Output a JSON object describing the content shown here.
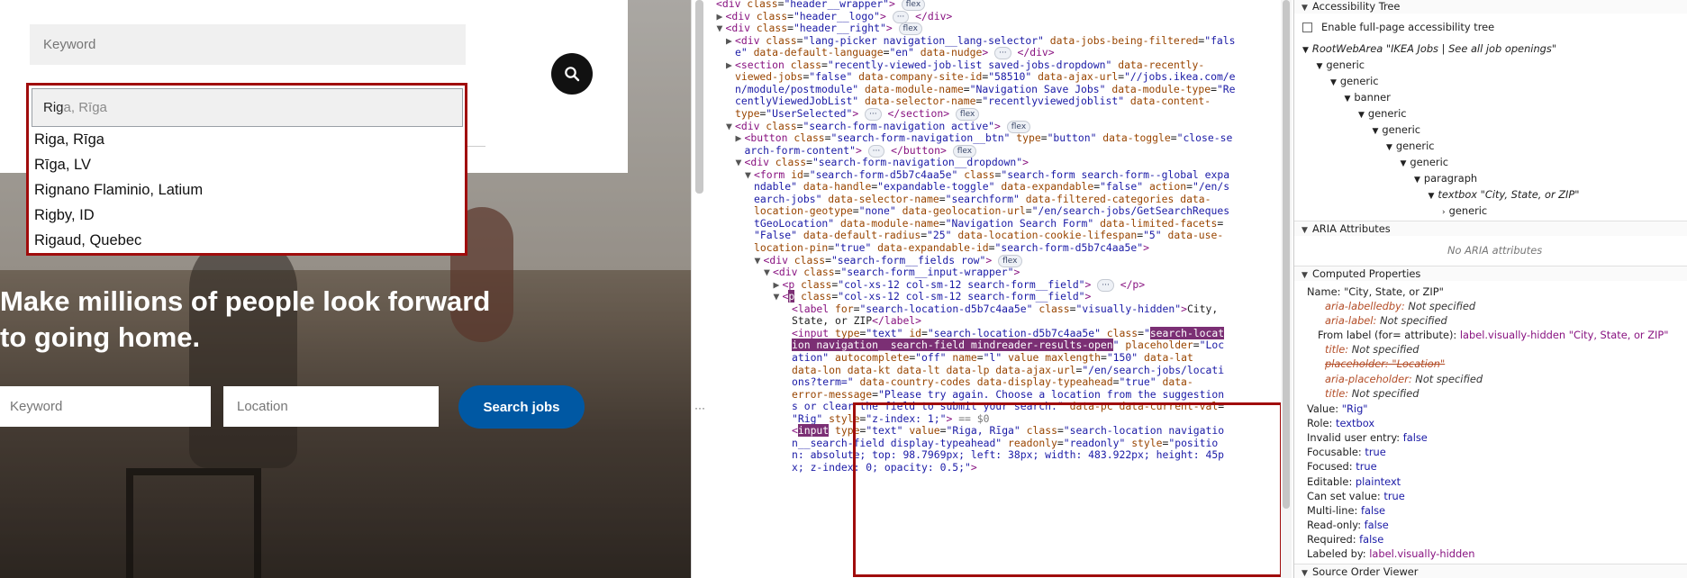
{
  "page": {
    "search_panel": {
      "keyword_placeholder": "Keyword",
      "location_typed": "Rig",
      "location_hint": "a, Rīga",
      "suggestions": [
        "Riga, Rīga",
        "Rīga, LV",
        "Rignano Flaminio, Latium",
        "Rigby, ID",
        "Rigaud, Quebec"
      ]
    },
    "hero": {
      "headline_line1": "Make millions of people look forward",
      "headline_line2": "to going home.",
      "keyword_placeholder": "Keyword",
      "location_placeholder": "Location",
      "search_button": "Search jobs"
    }
  },
  "elements": {
    "lines": [
      {
        "indent": 0,
        "tri": "",
        "html": "<span class=\"tag\">&lt;div</span> <span class=\"attr\">class</span>=<span class=\"val\">\"header__wrapper\"</span><span class=\"tag\">&gt;</span> <span class=\"badge\">flex</span>"
      },
      {
        "indent": 1,
        "tri": "▶",
        "html": "<span class=\"tag\">&lt;div</span> <span class=\"attr\">class</span>=<span class=\"val\">\"header__logo\"</span><span class=\"tag\">&gt;</span> <span class=\"badge\">···</span> <span class=\"tag\">&lt;/div&gt;</span>"
      },
      {
        "indent": 1,
        "tri": "▼",
        "html": "<span class=\"tag\">&lt;div</span> <span class=\"attr\">class</span>=<span class=\"val\">\"header__right\"</span><span class=\"tag\">&gt;</span> <span class=\"badge\">flex</span>"
      },
      {
        "indent": 2,
        "tri": "▶",
        "html": "<span class=\"tag\">&lt;div</span> <span class=\"attr\">class</span>=<span class=\"val\">\"lang-picker navigation__lang-selector\"</span> <span class=\"attr\">data-jobs-being-filtered</span>=<span class=\"val\">\"fals</span>"
      },
      {
        "indent": 2,
        "tri": "",
        "html": "<span class=\"val\">e\"</span> <span class=\"attr\">data-default-language</span>=<span class=\"val\">\"en\"</span> <span class=\"attr\">data-nudge</span><span class=\"tag\">&gt;</span> <span class=\"badge\">···</span> <span class=\"tag\">&lt;/div&gt;</span>"
      },
      {
        "indent": 2,
        "tri": "▶",
        "html": "<span class=\"tag\">&lt;section</span> <span class=\"attr\">class</span>=<span class=\"val\">\"recently-viewed-job-list saved-jobs-dropdown\"</span> <span class=\"attr\">data-recently-</span>"
      },
      {
        "indent": 2,
        "tri": "",
        "html": "<span class=\"attr\">viewed-jobs</span>=<span class=\"val\">\"false\"</span> <span class=\"attr\">data-company-site-id</span>=<span class=\"val\">\"58510\"</span> <span class=\"attr\">data-ajax-url</span>=<span class=\"val\">\"//jobs.ikea.com/e</span>"
      },
      {
        "indent": 2,
        "tri": "",
        "html": "<span class=\"val\">n/module/postmodule\"</span> <span class=\"attr\">data-module-name</span>=<span class=\"val\">\"Navigation Save Jobs\"</span> <span class=\"attr\">data-module-type</span>=<span class=\"val\">\"Re</span>"
      },
      {
        "indent": 2,
        "tri": "",
        "html": "<span class=\"val\">centlyViewedJobList\"</span> <span class=\"attr\">data-selector-name</span>=<span class=\"val\">\"recentlyviewedjoblist\"</span> <span class=\"attr\">data-content-</span>"
      },
      {
        "indent": 2,
        "tri": "",
        "html": "<span class=\"attr\">type</span>=<span class=\"val\">\"UserSelected\"</span><span class=\"tag\">&gt;</span> <span class=\"badge\">···</span> <span class=\"tag\">&lt;/section&gt;</span> <span class=\"badge\">flex</span>"
      },
      {
        "indent": 2,
        "tri": "▼",
        "html": "<span class=\"tag\">&lt;div</span> <span class=\"attr\">class</span>=<span class=\"val\">\"search-form-navigation active\"</span><span class=\"tag\">&gt;</span> <span class=\"badge\">flex</span>"
      },
      {
        "indent": 3,
        "tri": "▶",
        "html": "<span class=\"tag\">&lt;button</span> <span class=\"attr\">class</span>=<span class=\"val\">\"search-form-navigation__btn\"</span> <span class=\"attr\">type</span>=<span class=\"val\">\"button\"</span> <span class=\"attr\">data-toggle</span>=<span class=\"val\">\"close-se</span>"
      },
      {
        "indent": 3,
        "tri": "",
        "html": "<span class=\"val\">arch-form-content\"</span><span class=\"tag\">&gt;</span> <span class=\"badge\">···</span> <span class=\"tag\">&lt;/button&gt;</span> <span class=\"badge\">flex</span>"
      },
      {
        "indent": 3,
        "tri": "▼",
        "html": "<span class=\"tag\">&lt;div</span> <span class=\"attr\">class</span>=<span class=\"val\">\"search-form-navigation__dropdown\"</span><span class=\"tag\">&gt;</span>"
      },
      {
        "indent": 4,
        "tri": "▼",
        "html": "<span class=\"tag\">&lt;form</span> <span class=\"attr\">id</span>=<span class=\"val\">\"search-form-d5b7c4aa5e\"</span> <span class=\"attr\">class</span>=<span class=\"val\">\"search-form search-form--global expa</span>"
      },
      {
        "indent": 4,
        "tri": "",
        "html": "<span class=\"val\">ndable\"</span> <span class=\"attr\">data-handle</span>=<span class=\"val\">\"expandable-toggle\"</span> <span class=\"attr\">data-expandable</span>=<span class=\"val\">\"false\"</span> <span class=\"attr\">action</span>=<span class=\"val\">\"/en/s</span>"
      },
      {
        "indent": 4,
        "tri": "",
        "html": "<span class=\"val\">earch-jobs\"</span> <span class=\"attr\">data-selector-name</span>=<span class=\"val\">\"searchform\"</span> <span class=\"attr\">data-filtered-categories</span> <span class=\"attr\">data-</span>"
      },
      {
        "indent": 4,
        "tri": "",
        "html": "<span class=\"attr\">location-geotype</span>=<span class=\"val\">\"none\"</span> <span class=\"attr\">data-geolocation-url</span>=<span class=\"val\">\"/en/search-jobs/GetSearchReques</span>"
      },
      {
        "indent": 4,
        "tri": "",
        "html": "<span class=\"val\">tGeoLocation\"</span> <span class=\"attr\">data-module-name</span>=<span class=\"val\">\"Navigation Search Form\"</span> <span class=\"attr\">data-limited-facets</span>="
      },
      {
        "indent": 4,
        "tri": "",
        "html": "<span class=\"val\">\"False\"</span> <span class=\"attr\">data-default-radius</span>=<span class=\"val\">\"25\"</span> <span class=\"attr\">data-location-cookie-lifespan</span>=<span class=\"val\">\"5\"</span> <span class=\"attr\">data-use-</span>"
      },
      {
        "indent": 4,
        "tri": "",
        "html": "<span class=\"attr\">location-pin</span>=<span class=\"val\">\"true\"</span> <span class=\"attr\">data-expandable-id</span>=<span class=\"val\">\"search-form-d5b7c4aa5e\"</span><span class=\"tag\">&gt;</span>"
      },
      {
        "indent": 5,
        "tri": "▼",
        "html": "<span class=\"tag\">&lt;div</span> <span class=\"attr\">class</span>=<span class=\"val\">\"search-form__fields row\"</span><span class=\"tag\">&gt;</span> <span class=\"badge\">flex</span>"
      },
      {
        "indent": 6,
        "tri": "▼",
        "html": "<span class=\"tag\">&lt;div</span> <span class=\"attr\">class</span>=<span class=\"val\">\"search-form__input-wrapper\"</span><span class=\"tag\">&gt;</span>"
      },
      {
        "indent": 7,
        "tri": "▶",
        "html": "<span class=\"tag\">&lt;p</span> <span class=\"attr\">class</span>=<span class=\"val\">\"col-xs-12 col-sm-12 search-form__field\"</span><span class=\"tag\">&gt;</span> <span class=\"badge\">···</span> <span class=\"tag\">&lt;/p&gt;</span>"
      },
      {
        "indent": 7,
        "tri": "▼",
        "html": "<span class=\"tag\">&lt;</span><span class=\"hl\">p</span> <span class=\"attr\">class</span>=<span class=\"val\">\"col-xs-12 col-sm-12 search-form__field\"</span><span class=\"tag\">&gt;</span>"
      },
      {
        "indent": 8,
        "tri": "",
        "html": "<span class=\"tag\">&lt;label</span> <span class=\"attr\">for</span>=<span class=\"val\">\"search-location-d5b7c4aa5e\"</span> <span class=\"attr\">class</span>=<span class=\"val\">\"visually-hidden\"</span><span class=\"tag\">&gt;</span><span class=\"txt\">City,</span>"
      },
      {
        "indent": 8,
        "tri": "",
        "html": "<span class=\"txt\">State, or ZIP</span><span class=\"tag\">&lt;/label&gt;</span>"
      },
      {
        "indent": 8,
        "tri": "",
        "html": "<span class=\"tag\">&lt;input</span> <span class=\"attr\">type</span>=<span class=\"val\">\"text\"</span> <span class=\"attr\">id</span>=<span class=\"val\">\"search-location-d5b7c4aa5e\"</span> <span class=\"attr\">class</span>=<span class=\"val\">\"</span><span class=\"hl\">search-locat</span>"
      },
      {
        "indent": 8,
        "tri": "",
        "html": "<span class=\"hl\">ion navigation__search-field mindreader-results-open</span><span class=\"val\">\"</span> <span class=\"attr\">placeholder</span>=<span class=\"val\">\"Loc</span>"
      },
      {
        "indent": 8,
        "tri": "",
        "html": "<span class=\"val\">ation\"</span> <span class=\"attr\">autocomplete</span>=<span class=\"val\">\"off\"</span> <span class=\"attr\">name</span>=<span class=\"val\">\"l\"</span> <span class=\"attr\">value</span> <span class=\"attr\">maxlength</span>=<span class=\"val\">\"150\"</span> <span class=\"attr\">data-lat</span>"
      },
      {
        "indent": 8,
        "tri": "",
        "html": "<span class=\"attr\">data-lon data-kt data-lt data-lp data-ajax-url</span>=<span class=\"val\">\"/en/search-jobs/locati</span>"
      },
      {
        "indent": 8,
        "tri": "",
        "html": "<span class=\"val\">ons?term=\"</span> <span class=\"attr\">data-country-codes data-display-typeahead</span>=<span class=\"val\">\"true\"</span> <span class=\"attr\">data-</span>"
      },
      {
        "indent": 8,
        "tri": "",
        "html": "<span class=\"attr\">error-message</span>=<span class=\"val\">\"Please try again. Choose a location from the suggestion</span>"
      },
      {
        "indent": 8,
        "tri": "",
        "html": "<span class=\"val\">s or clear the field to submit your search.\"</span> <span class=\"attr\">data-pc data-current-val</span>="
      },
      {
        "indent": 8,
        "tri": "",
        "html": "<span class=\"val\">\"Rig\"</span> <span class=\"attr\">style</span>=<span class=\"val\">\"z-index: 1;\"</span><span class=\"tag\">&gt;</span> <span class=\"dim\">== $0</span>"
      },
      {
        "indent": 8,
        "tri": "",
        "html": "<span class=\"tag\">&lt;</span><span class=\"hl\">input</span> <span class=\"attr\">type</span>=<span class=\"val\">\"text\"</span> <span class=\"attr\">value</span>=<span class=\"val\">\"Riga, Rīga\"</span> <span class=\"attr\">class</span>=<span class=\"val\">\"search-location navigatio</span>"
      },
      {
        "indent": 8,
        "tri": "",
        "html": "<span class=\"val\">n__search-field display-typeahead\"</span> <span class=\"attr\">readonly</span>=<span class=\"val\">\"readonly\"</span> <span class=\"attr\">style</span>=<span class=\"val\">\"positio</span>"
      },
      {
        "indent": 8,
        "tri": "",
        "html": "<span class=\"val\">n: absolute; top: 98.7969px; left: 38px; width: 483.922px; height: 45p</span>"
      },
      {
        "indent": 8,
        "tri": "",
        "html": "<span class=\"val\">x; z-index: 0; opacity: 0.5;\"</span><span class=\"tag\">&gt;</span>"
      }
    ],
    "gutter_ellipsis": "···"
  },
  "a11y": {
    "tree_header": "Accessibility Tree",
    "enable_label": "Enable full-page accessibility tree",
    "tree": [
      {
        "indent": 0,
        "tri": "▼",
        "text": "RootWebArea \"IKEA Jobs | See all job openings\"",
        "italic": true
      },
      {
        "indent": 1,
        "tri": "▼",
        "text": "generic"
      },
      {
        "indent": 2,
        "tri": "▼",
        "text": "generic"
      },
      {
        "indent": 3,
        "tri": "▼",
        "text": "banner"
      },
      {
        "indent": 4,
        "tri": "▼",
        "text": "generic"
      },
      {
        "indent": 5,
        "tri": "▼",
        "text": "generic"
      },
      {
        "indent": 6,
        "tri": "▼",
        "text": "generic"
      },
      {
        "indent": 7,
        "tri": "▼",
        "text": "generic"
      },
      {
        "indent": 8,
        "tri": "▼",
        "text": "paragraph"
      },
      {
        "indent": 9,
        "tri": "▼",
        "text": "textbox \"City, State, or ZIP\"",
        "italic": true
      },
      {
        "indent": 10,
        "tri": "›",
        "text": "generic"
      }
    ],
    "aria_header": "ARIA Attributes",
    "aria_empty": "No ARIA attributes",
    "computed_header": "Computed Properties",
    "name_label": "Name: \"City, State, or ZIP\"",
    "name_details": [
      {
        "key": "aria-labelledby",
        "value": "Not specified",
        "style": "orange"
      },
      {
        "key": "aria-label",
        "value": "Not specified",
        "style": "orange"
      },
      {
        "key": "From label (for= attribute):",
        "value": "label.visually-hidden \"City, State, or ZIP\"",
        "style": "from"
      },
      {
        "key": "title",
        "value": "Not specified",
        "style": "orange"
      },
      {
        "key": "placeholder",
        "value": "\"Location\"",
        "style": "strike"
      },
      {
        "key": "aria-placeholder",
        "value": "Not specified",
        "style": "orange"
      },
      {
        "key": "title",
        "value": "Not specified",
        "style": "orange"
      }
    ],
    "props": [
      {
        "key": "Value:",
        "value": "\"Rig\""
      },
      {
        "key": "Role:",
        "value": "textbox"
      },
      {
        "key": "Invalid user entry:",
        "value": "false"
      },
      {
        "key": "Focusable:",
        "value": "true"
      },
      {
        "key": "Focused:",
        "value": "true"
      },
      {
        "key": "Editable:",
        "value": "plaintext"
      },
      {
        "key": "Can set value:",
        "value": "true"
      },
      {
        "key": "Multi-line:",
        "value": "false"
      },
      {
        "key": "Read-only:",
        "value": "false"
      },
      {
        "key": "Required:",
        "value": "false"
      },
      {
        "key": "Labeled by:",
        "value": "label.visually-hidden"
      }
    ],
    "source_header": "Source Order Viewer"
  }
}
